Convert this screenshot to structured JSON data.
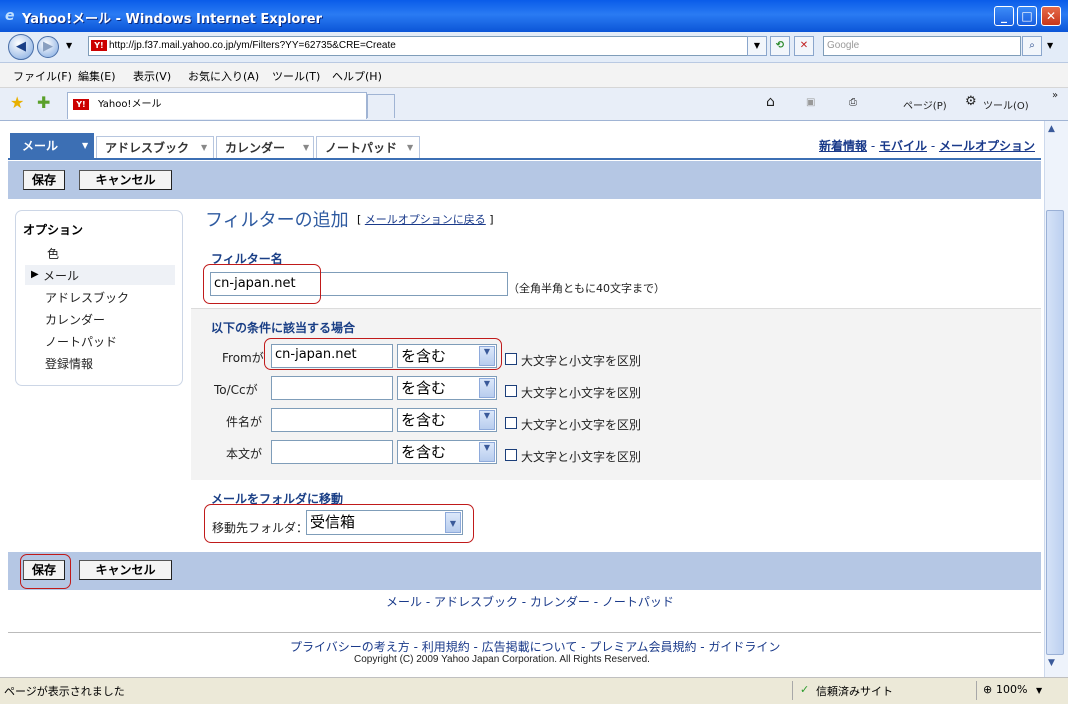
{
  "window": {
    "title": "Yahoo!メール - Windows Internet Explorer"
  },
  "address": {
    "url": "http://jp.f37.mail.yahoo.co.jp/ym/Filters?YY=62735&CRE=Create",
    "search_placeholder": "Google"
  },
  "menu": [
    "ファイル(F)",
    "編集(E)",
    "表示(V)",
    "お気に入り(A)",
    "ツール(T)",
    "ヘルプ(H)"
  ],
  "browser_tab": {
    "label": "Yahoo!メール"
  },
  "commands": {
    "page": "ページ(P)",
    "tools": "ツール(O)"
  },
  "nav_tabs": [
    "メール",
    "アドレスブック",
    "カレンダー",
    "ノートパッド"
  ],
  "top_links": {
    "new": "新着情報",
    "sep1": " - ",
    "mobile": "モバイル",
    "sep2": " - ",
    "options": "メールオプション"
  },
  "toolbar": {
    "save": "保存",
    "cancel": "キャンセル"
  },
  "sidebar": {
    "title": "オプション",
    "items": [
      "色",
      "メール",
      "アドレスブック",
      "カレンダー",
      "ノートパッド",
      "登録情報"
    ]
  },
  "page": {
    "title": "フィルターの追加",
    "back_open": "[ ",
    "back_link": "メールオプションに戻る",
    "back_close": " ]"
  },
  "filter_name": {
    "heading": "フィルター名",
    "value": "cn-japan.net",
    "note": "（全角半角ともに40文字まで）"
  },
  "conditions": {
    "heading": "以下の条件に該当する場合",
    "rows": [
      {
        "label": "Fromが",
        "value": "cn-japan.net",
        "op": "を含む",
        "case": "大文字と小文字を区別"
      },
      {
        "label": "To/Ccが",
        "value": "",
        "op": "を含む",
        "case": "大文字と小文字を区別"
      },
      {
        "label": "件名が",
        "value": "",
        "op": "を含む",
        "case": "大文字と小文字を区別"
      },
      {
        "label": "本文が",
        "value": "",
        "op": "を含む",
        "case": "大文字と小文字を区別"
      }
    ]
  },
  "move": {
    "heading": "メールをフォルダに移動",
    "label": "移動先フォルダ：",
    "folder": "受信箱"
  },
  "footer": {
    "nav": "メール - アドレスブック - カレンダー - ノートパッド",
    "links": "プライバシーの考え方 - 利用規約 - 広告掲載について - プレミアム会員規約 - ガイドライン",
    "copyright": "Copyright (C) 2009 Yahoo Japan Corporation. All Rights Reserved."
  },
  "status": {
    "text": "ページが表示されました",
    "zone": "信頼済みサイト",
    "zoom": "100%"
  },
  "colors": {
    "nav_blue": "#3c6fb4",
    "bar_blue": "#b5c7e4",
    "highlight_red": "#c01a1a"
  }
}
